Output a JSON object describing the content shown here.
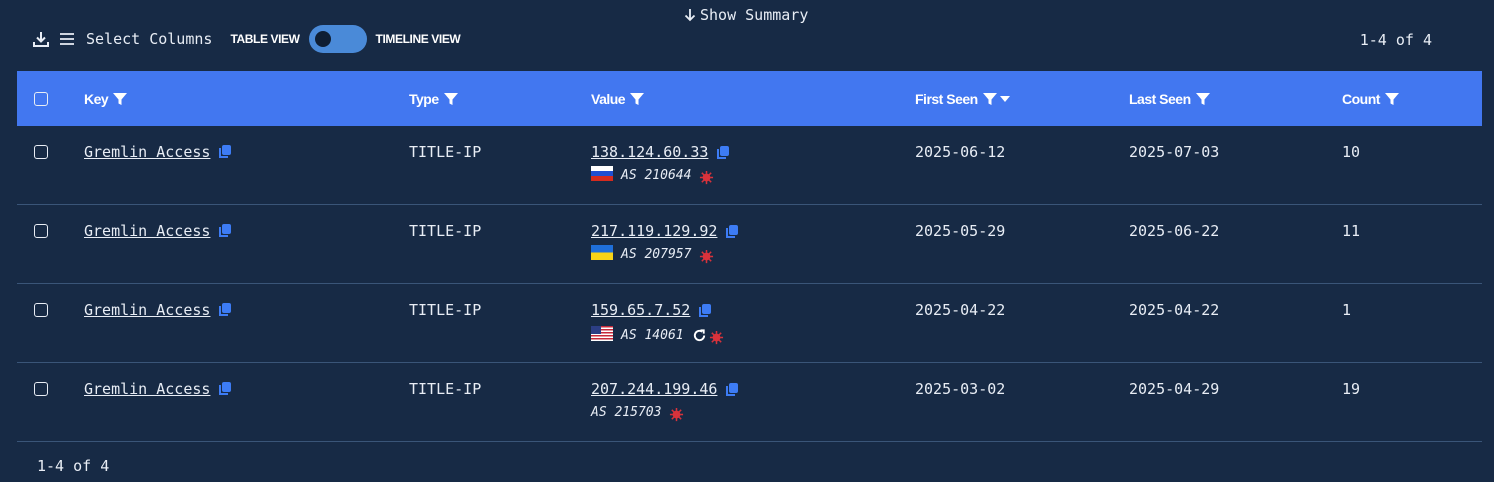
{
  "header": {
    "show_summary": "Show Summary",
    "select_columns": "Select Columns",
    "table_view": "TABLE VIEW",
    "timeline_view": "TIMELINE VIEW",
    "pager": "1-4 of 4"
  },
  "table": {
    "columns": [
      "Key",
      "Type",
      "Value",
      "First Seen",
      "Last Seen",
      "Count"
    ],
    "rows": [
      {
        "key": "Gremlin Access",
        "type": "TITLE-IP",
        "ip": "138.124.60.33",
        "flag": "ru",
        "as": "AS 210644",
        "first_seen": "2025-06-12",
        "last_seen": "2025-07-03",
        "count": "10"
      },
      {
        "key": "Gremlin Access",
        "type": "TITLE-IP",
        "ip": "217.119.129.92",
        "flag": "ua",
        "as": "AS 207957",
        "first_seen": "2025-05-29",
        "last_seen": "2025-06-22",
        "count": "11"
      },
      {
        "key": "Gremlin Access",
        "type": "TITLE-IP",
        "ip": "159.65.7.52",
        "flag": "us",
        "as": "AS 14061",
        "first_seen": "2025-04-22",
        "last_seen": "2025-04-22",
        "count": "1"
      },
      {
        "key": "Gremlin Access",
        "type": "TITLE-IP",
        "ip": "207.244.199.46",
        "flag": "",
        "as": "AS 215703",
        "first_seen": "2025-03-02",
        "last_seen": "2025-04-29",
        "count": "19"
      }
    ]
  },
  "footer": {
    "pager": "1-4 of 4"
  },
  "colors": {
    "background": "#172a45",
    "header": "#4277f0",
    "accent": "#3d7cf5",
    "threat": "#d9323b"
  },
  "icons": [
    "download-icon",
    "columns-icon",
    "filter-icon",
    "sort-desc-icon",
    "copy-icon",
    "malware-icon",
    "activity-icon",
    "arrow-down-icon"
  ]
}
